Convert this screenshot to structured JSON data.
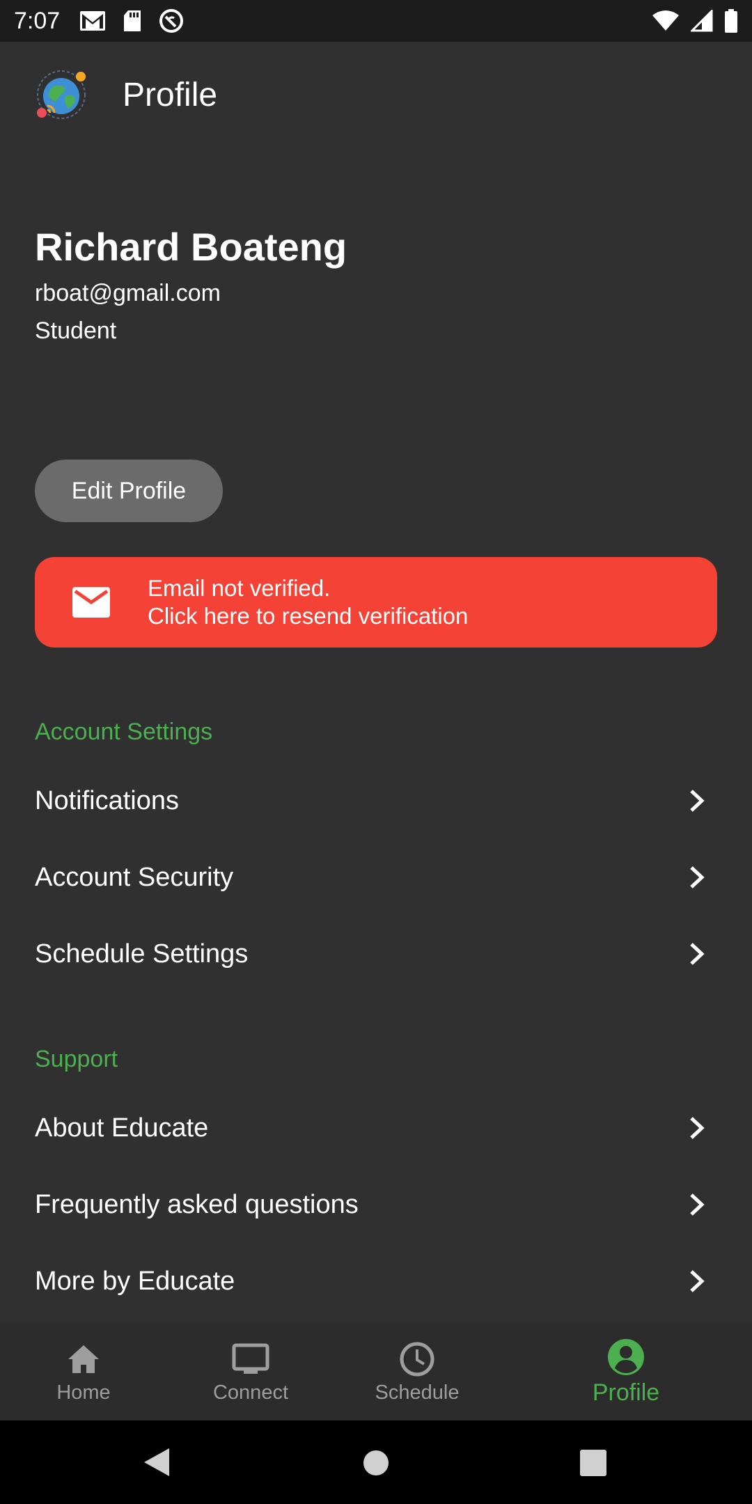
{
  "status_bar": {
    "time": "7:07"
  },
  "app_bar": {
    "title": "Profile"
  },
  "profile": {
    "name": "Richard Boateng",
    "email": "rboat@gmail.com",
    "role": "Student",
    "edit_label": "Edit Profile"
  },
  "verify_banner": {
    "line1": "Email not verified.",
    "line2": "Click here to resend verification",
    "color": "#f44336"
  },
  "account_settings": {
    "header": "Account Settings",
    "items": [
      {
        "label": "Notifications"
      },
      {
        "label": "Account Security"
      },
      {
        "label": "Schedule Settings"
      }
    ]
  },
  "support": {
    "header": "Support",
    "items": [
      {
        "label": "About Educate"
      },
      {
        "label": "Frequently asked questions"
      },
      {
        "label": "More by Educate"
      }
    ]
  },
  "bottom_nav": {
    "items": [
      {
        "label": "Home",
        "icon": "home-icon"
      },
      {
        "label": "Connect",
        "icon": "monitor-icon"
      },
      {
        "label": "Schedule",
        "icon": "clock-icon"
      },
      {
        "label": "Profile",
        "icon": "account-circle-icon",
        "active": true
      }
    ]
  },
  "colors": {
    "accent": "#4caf50",
    "background": "#303030",
    "error": "#f44336"
  }
}
